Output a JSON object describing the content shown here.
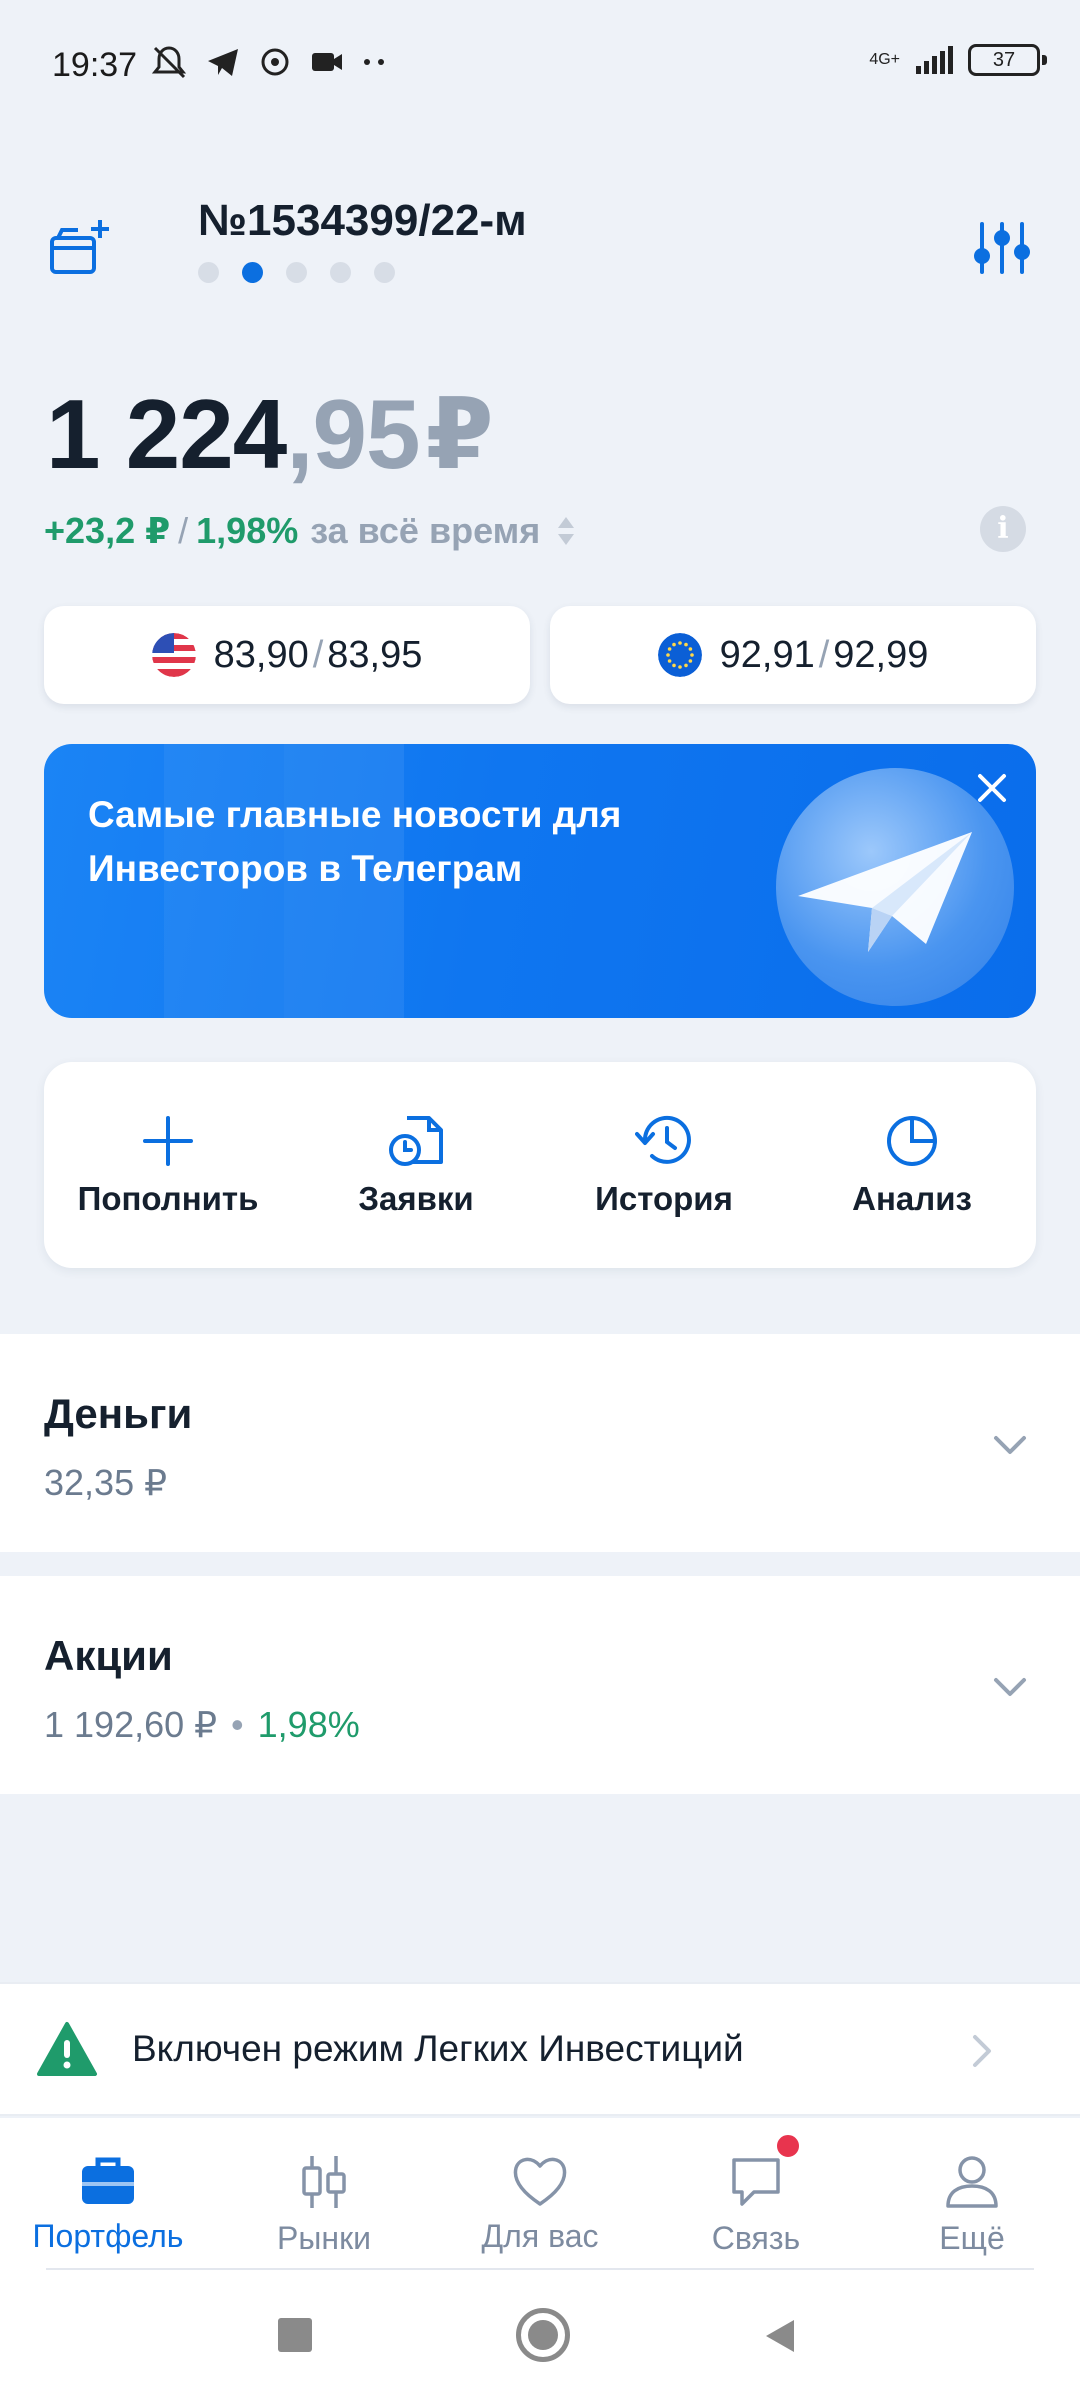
{
  "status_bar": {
    "time": "19:37",
    "network": "4G+",
    "battery": "37"
  },
  "header": {
    "account_number": "№1534399/22-м",
    "page_dots": 5,
    "active_dot": 1
  },
  "balance": {
    "integer": "1 224",
    "fraction": ",95",
    "currency": "₽",
    "change_abs": "+23,2 ₽",
    "separator": "/",
    "change_pct": "1,98%",
    "period": "за всё время"
  },
  "currencies": [
    {
      "icon": "usd-flag-icon",
      "bid": "83,90",
      "sep": "/",
      "ask": "83,95"
    },
    {
      "icon": "eur-flag-icon",
      "bid": "92,91",
      "sep": "/",
      "ask": "92,99"
    }
  ],
  "promo": {
    "text": "Самые главные новости для Инвесторов в Телеграм"
  },
  "actions": [
    {
      "label": "Пополнить",
      "icon": "plus-icon"
    },
    {
      "label": "Заявки",
      "icon": "orders-icon"
    },
    {
      "label": "История",
      "icon": "history-icon"
    },
    {
      "label": "Анализ",
      "icon": "pie-chart-icon"
    }
  ],
  "sections": {
    "money": {
      "title": "Деньги",
      "value": "32,35 ₽"
    },
    "stocks": {
      "title": "Акции",
      "value": "1 192,60 ₽",
      "bullet": "•",
      "change": "1,98%"
    }
  },
  "easy_invest": {
    "text": "Включен режим Легких Инвестиций"
  },
  "bottom_nav": [
    {
      "label": "Портфель",
      "icon": "briefcase-icon",
      "active": true
    },
    {
      "label": "Рынки",
      "icon": "candles-icon",
      "active": false
    },
    {
      "label": "Для вас",
      "icon": "heart-icon",
      "active": false
    },
    {
      "label": "Связь",
      "icon": "chat-icon",
      "active": false
    },
    {
      "label": "Ещё",
      "icon": "profile-icon",
      "active": false
    }
  ],
  "colors": {
    "accent": "#0b6fe0",
    "positive": "#1f9b6b",
    "muted": "#96a3b4",
    "background": "#eef2f8",
    "badge": "#e8344e"
  }
}
